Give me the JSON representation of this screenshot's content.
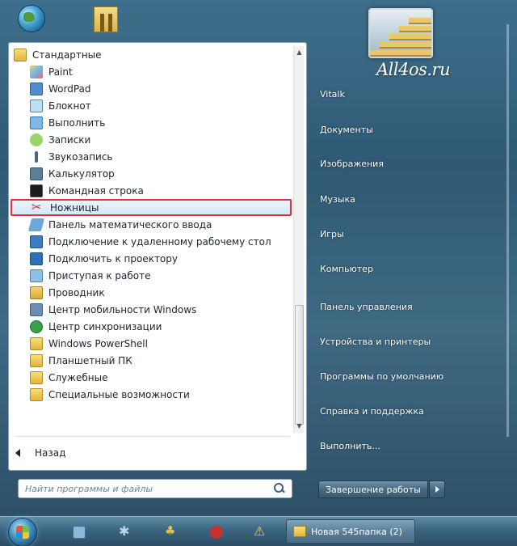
{
  "watermark": "All4os.ru",
  "programs": {
    "folder": "Стандартные",
    "items": [
      {
        "label": "Paint",
        "icon": "paint-icon"
      },
      {
        "label": "WordPad",
        "icon": "wordpad-icon"
      },
      {
        "label": "Блокнот",
        "icon": "notepad-icon"
      },
      {
        "label": "Выполнить",
        "icon": "run-icon"
      },
      {
        "label": "Записки",
        "icon": "sticky-notes-icon"
      },
      {
        "label": "Звукозапись",
        "icon": "microphone-icon"
      },
      {
        "label": "Калькулятор",
        "icon": "calculator-icon"
      },
      {
        "label": "Командная строка",
        "icon": "cmd-icon"
      },
      {
        "label": "Ножницы",
        "icon": "scissors-icon",
        "selected": true
      },
      {
        "label": "Панель математического ввода",
        "icon": "math-input-icon"
      },
      {
        "label": "Подключение к удаленному рабочему стол",
        "icon": "remote-desktop-icon"
      },
      {
        "label": "Подключить к проектору",
        "icon": "projector-icon"
      },
      {
        "label": "Приступая к работе",
        "icon": "getting-started-icon"
      },
      {
        "label": "Проводник",
        "icon": "explorer-icon"
      },
      {
        "label": "Центр мобильности Windows",
        "icon": "mobility-center-icon"
      },
      {
        "label": "Центр синхронизации",
        "icon": "sync-center-icon"
      },
      {
        "label": "Windows PowerShell",
        "icon": "folder-icon"
      },
      {
        "label": "Планшетный ПК",
        "icon": "folder-icon"
      },
      {
        "label": "Служебные",
        "icon": "folder-icon"
      },
      {
        "label": "Специальные возможности",
        "icon": "folder-icon"
      }
    ],
    "back_label": "Назад"
  },
  "search": {
    "placeholder": "Найти программы и файлы"
  },
  "right_pane": {
    "items": [
      "Vitalk",
      "Документы",
      "Изображения",
      "Музыка",
      "Игры",
      "Компьютер",
      "Панель управления",
      "Устройства и принтеры",
      "Программы по умолчанию",
      "Справка и поддержка",
      "Выполнить..."
    ],
    "shutdown_label": "Завершение работы"
  },
  "taskbar": {
    "window_label": "Новая 545папка (2)"
  },
  "colors": {
    "selection_border": "#d9343a",
    "menu_bg": "#ffffff",
    "desktop_bg": "#2f5974"
  }
}
